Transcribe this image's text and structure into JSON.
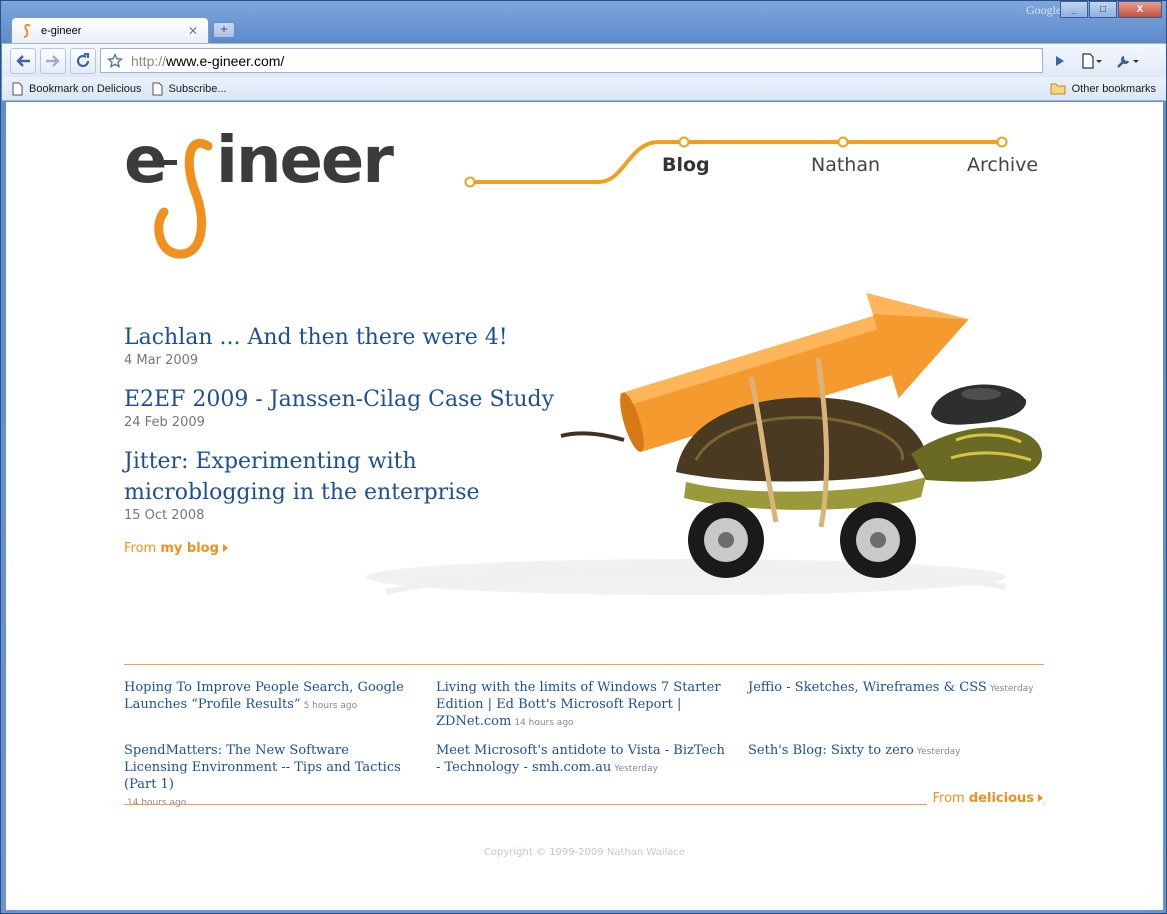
{
  "browser": {
    "tab_title": "e-gineer",
    "brand": "Google",
    "url_scheme": "http://",
    "url_host": "www.e-gineer.com/",
    "bookmarks": [
      "Bookmark on Delicious",
      "Subscribe..."
    ],
    "other_bookmarks": "Other bookmarks",
    "window_buttons": [
      "_",
      "□",
      "X"
    ]
  },
  "site": {
    "logo_text": "e-gineer",
    "nav": [
      {
        "label": "Blog",
        "active": true
      },
      {
        "label": "Nathan",
        "active": false
      },
      {
        "label": "Archive",
        "active": false
      }
    ],
    "accent_color": "#f0901e",
    "link_color": "#1d4f96"
  },
  "blog": {
    "posts": [
      {
        "title": "Lachlan ... And then there were 4!",
        "date": "4 Mar 2009"
      },
      {
        "title": "E2EF 2009 - Janssen-Cilag Case Study",
        "date": "24 Feb 2009"
      },
      {
        "title": "Jitter: Experimenting with microblogging in the enterprise",
        "date": "15 Oct 2008"
      }
    ],
    "from_prefix": "From",
    "from_source": "my blog"
  },
  "delicious": {
    "links": [
      {
        "title": "Hoping To Improve People Search, Google Launches “Profile Results”",
        "ago": "5 hours ago"
      },
      {
        "title": "Living with the limits of Windows 7 Starter Edition | Ed Bott's Microsoft Report | ZDNet.com",
        "ago": "14 hours ago"
      },
      {
        "title": "Jeffio - Sketches, Wireframes & CSS",
        "ago": "Yesterday"
      },
      {
        "title": "SpendMatters: The New Software Licensing Environment -- Tips and Tactics (Part 1)",
        "ago": "14 hours ago"
      },
      {
        "title": "Meet Microsoft's antidote to Vista - BizTech - Technology - smh.com.au",
        "ago": "Yesterday"
      },
      {
        "title": "Seth's Blog: Sixty to zero",
        "ago": "Yesterday"
      }
    ],
    "from_prefix": "From",
    "from_source": "delicious"
  },
  "footer": {
    "copyright": "Copyright © 1999-2009 Nathan Wallace"
  }
}
